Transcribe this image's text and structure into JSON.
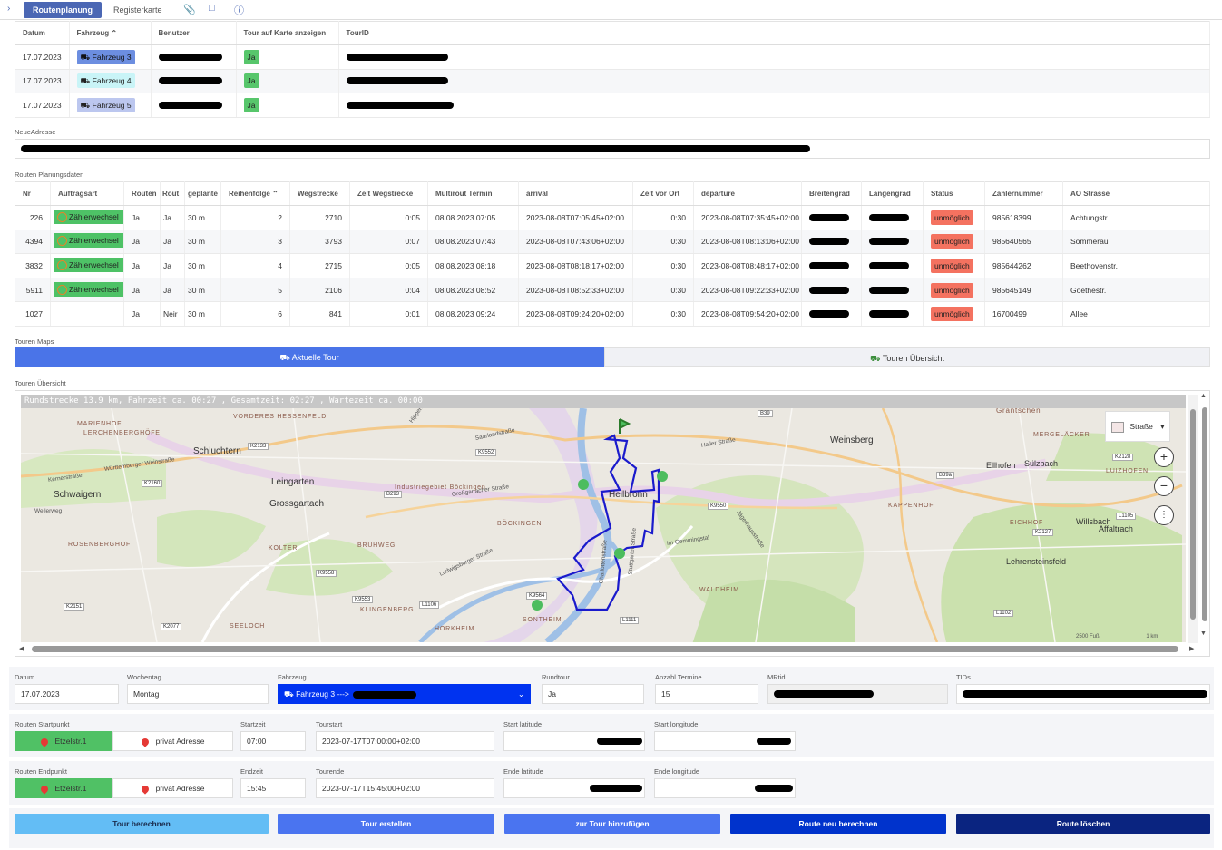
{
  "tabs": {
    "routenplanung": "Routenplanung",
    "registerkarte": "Registerkarte"
  },
  "tours_table": {
    "headers": [
      "Datum",
      "Fahrzeug",
      "Benutzer",
      "Tour auf Karte anzeigen",
      "TourID"
    ],
    "rows": [
      {
        "datum": "17.07.2023",
        "fahrzeug": "Fahrzeug 3",
        "karte": "Ja"
      },
      {
        "datum": "17.07.2023",
        "fahrzeug": "Fahrzeug 4",
        "karte": "Ja"
      },
      {
        "datum": "17.07.2023",
        "fahrzeug": "Fahrzeug 5",
        "karte": "Ja"
      }
    ]
  },
  "neue_adresse": {
    "label": "NeueAdresse"
  },
  "planung": {
    "label": "Routen Planungsdaten",
    "headers": [
      "Nr",
      "Auftragsart",
      "Routen",
      "Rout",
      "geplante",
      "Reihenfolge",
      "Wegstrecke",
      "Zeit Wegstrecke",
      "Multirout Termin",
      "arrival",
      "Zeit vor Ort",
      "departure",
      "Breitengrad",
      "Längengrad",
      "Status",
      "Zählernummer",
      "AO Strasse"
    ],
    "rows": [
      {
        "nr": "226",
        "art": "Zählerwechsel",
        "routen": "Ja",
        "rout": "Ja",
        "geplant": "30 m",
        "reihe": "2",
        "weg": "2710",
        "zeit": "0:05",
        "termin": "08.08.2023 07:05",
        "arrival": "2023-08-08T07:05:45+02:00",
        "vorort": "0:30",
        "departure": "2023-08-08T07:35:45+02:00",
        "status": "unmöglich",
        "zaehler": "985618399",
        "strasse": "Achtungstr"
      },
      {
        "nr": "4394",
        "art": "Zählerwechsel",
        "routen": "Ja",
        "rout": "Ja",
        "geplant": "30 m",
        "reihe": "3",
        "weg": "3793",
        "zeit": "0:07",
        "termin": "08.08.2023 07:43",
        "arrival": "2023-08-08T07:43:06+02:00",
        "vorort": "0:30",
        "departure": "2023-08-08T08:13:06+02:00",
        "status": "unmöglich",
        "zaehler": "985640565",
        "strasse": "Sommerau"
      },
      {
        "nr": "3832",
        "art": "Zählerwechsel",
        "routen": "Ja",
        "rout": "Ja",
        "geplant": "30 m",
        "reihe": "4",
        "weg": "2715",
        "zeit": "0:05",
        "termin": "08.08.2023 08:18",
        "arrival": "2023-08-08T08:18:17+02:00",
        "vorort": "0:30",
        "departure": "2023-08-08T08:48:17+02:00",
        "status": "unmöglich",
        "zaehler": "985644262",
        "strasse": "Beethovenstr."
      },
      {
        "nr": "5911",
        "art": "Zählerwechsel",
        "routen": "Ja",
        "rout": "Ja",
        "geplant": "30 m",
        "reihe": "5",
        "weg": "2106",
        "zeit": "0:04",
        "termin": "08.08.2023 08:52",
        "arrival": "2023-08-08T08:52:33+02:00",
        "vorort": "0:30",
        "departure": "2023-08-08T09:22:33+02:00",
        "status": "unmöglich",
        "zaehler": "985645149",
        "strasse": "Goethestr."
      },
      {
        "nr": "1027",
        "art": "",
        "routen": "Ja",
        "rout": "Neir",
        "geplant": "30 m",
        "reihe": "6",
        "weg": "841",
        "zeit": "0:01",
        "termin": "08.08.2023 09:24",
        "arrival": "2023-08-08T09:24:20+02:00",
        "vorort": "0:30",
        "departure": "2023-08-08T09:54:20+02:00",
        "status": "unmöglich",
        "zaehler": "16700499",
        "strasse": "Allee"
      }
    ]
  },
  "maps": {
    "label": "Touren Maps",
    "tab_current": "Aktuelle Tour",
    "tab_overview": "Touren Übersicht"
  },
  "uebersicht": {
    "label": "Touren Übersicht",
    "info": "Rundstrecke 13.9 km, Fahrzeit ca. 00:27 , Gesamtzeit: 02:27 , Wartezeit ca. 00:00",
    "layer": "Straße",
    "places": [
      "Schluchtern",
      "Leingarten",
      "Grossgartach",
      "Schwaigern",
      "Heilbronn",
      "Weinsberg",
      "Ellhofen",
      "Sülzbach",
      "Willsbach",
      "Affaltrach",
      "Lehrensteinsfeld",
      "BÖCKINGEN",
      "KLINGENBERG",
      "SONTHEIM",
      "HORKHEIM",
      "BRUHWEG",
      "KOLTER",
      "SEELOCH",
      "ROSENBERGHOF",
      "WALDHEIM",
      "KAPPENHOF",
      "EICHHOF",
      "MERGELÄCKER",
      "LUIZHOFEN",
      "MARIENHOF",
      "LERCHENBERGHÖFE",
      "VORDERES HESSENFELD",
      "Grantschen",
      "Industriegebiet Böckingen"
    ],
    "roads": [
      "Saarlandstraße",
      "Hipperich",
      "Haller Straße",
      "Großgartacher Straße",
      "Württemberger Weinstraße",
      "Ludwigsburger Straße",
      "Charlottenstraße",
      "Stuttgarter Straße",
      "Im Gemmingstal",
      "Jägerhausstraße",
      "Kernerstraße",
      "Wellerweg"
    ],
    "road_numbers": [
      "B39",
      "B39a",
      "B293",
      "K2133",
      "K2160",
      "K9550",
      "K9564",
      "K9552",
      "L1105",
      "L1106",
      "L1111",
      "K2127",
      "K2128",
      "L1102",
      "K2151",
      "K2077",
      "K9553",
      "K9558"
    ],
    "scale": "2500 Fuß",
    "scale_km": "1 km"
  },
  "form": {
    "datum_label": "Datum",
    "datum": "17.07.2023",
    "wochentag_label": "Wochentag",
    "wochentag": "Montag",
    "fahrzeug_label": "Fahrzeug",
    "fahrzeug": "Fahrzeug 3 --->",
    "rundtour_label": "Rundtour",
    "rundtour": "Ja",
    "anzahl_label": "Anzahl Termine",
    "anzahl": "15",
    "mrtid_label": "MRtid",
    "tids_label": "TIDs",
    "start_label": "Routen Startpunkt",
    "start_home": "Etzelstr.1",
    "start_privat": "privat Adresse",
    "startzeit_label": "Startzeit",
    "startzeit": "07:00",
    "tourstart_label": "Tourstart",
    "tourstart": "2023-07-17T07:00:00+02:00",
    "start_lat_label": "Start latitude",
    "start_lon_label": "Start longitude",
    "end_label": "Routen Endpunkt",
    "end_home": "Etzelstr.1",
    "end_privat": "privat Adresse",
    "endzeit_label": "Endzeit",
    "endzeit": "15:45",
    "tourende_label": "Tourende",
    "tourende": "2023-07-17T15:45:00+02:00",
    "end_lat_label": "Ende latitude",
    "end_lon_label": "Ende longitude"
  },
  "buttons": {
    "berechnen": "Tour berechnen",
    "erstellen": "Tour erstellen",
    "hinzufuegen": "zur Tour hinzufügen",
    "neu": "Route neu berechnen",
    "loeschen": "Route löschen"
  },
  "colors": {
    "primary": "#4b67b4",
    "green": "#57c66b",
    "status_red": "#f47260",
    "route": "#1a1acc"
  }
}
